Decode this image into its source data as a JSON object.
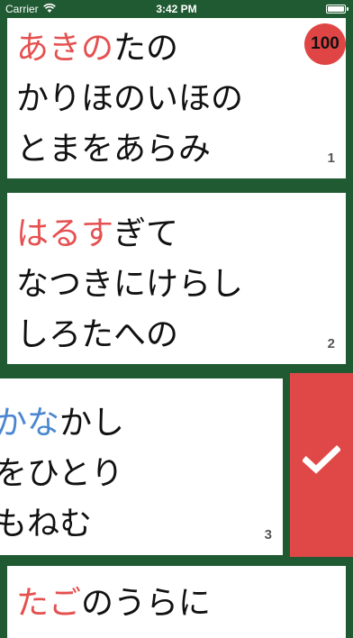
{
  "status_bar": {
    "carrier": "Carrier",
    "time": "3:42 PM",
    "battery_level": 1.0
  },
  "score": "100",
  "cards": [
    {
      "number": "1",
      "lines": [
        {
          "highlight": "あきの",
          "rest": "たの"
        },
        {
          "highlight": "",
          "rest": "かりほのいほの"
        },
        {
          "highlight": "",
          "rest": "とまをあらみ"
        }
      ]
    },
    {
      "number": "2",
      "lines": [
        {
          "highlight": "はるす",
          "rest": "ぎて"
        },
        {
          "highlight": "",
          "rest": "なつきにけらし"
        },
        {
          "highlight": "",
          "rest": "しろたへの"
        }
      ]
    },
    {
      "number": "3",
      "lines": [
        {
          "highlight": "かな",
          "rest": "かし"
        },
        {
          "highlight": "",
          "rest": "をひとり"
        },
        {
          "highlight": "",
          "rest": "もねむ"
        }
      ]
    },
    {
      "number": "",
      "lines": [
        {
          "highlight": "たご",
          "rest": "のうらに"
        }
      ]
    }
  ],
  "swipe_action": {
    "icon": "checkmark-icon"
  },
  "colors": {
    "background": "#1f5a32",
    "highlight_red": "#e55050",
    "highlight_blue": "#4a86d0",
    "action_red": "#e04848"
  }
}
